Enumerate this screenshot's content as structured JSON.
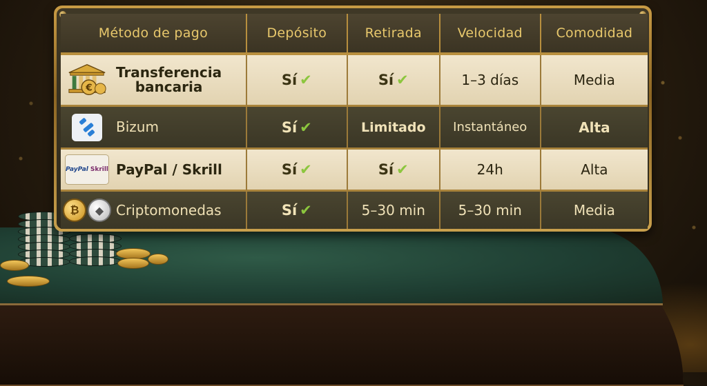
{
  "headers": {
    "method": "Método de pago",
    "deposit": "Depósito",
    "withdrawal": "Retirada",
    "speed": "Velocidad",
    "convenience": "Comodidad"
  },
  "rows": [
    {
      "method_line1": "Transferencia",
      "method_line2": "bancaria",
      "icon": "bank-euro-icon",
      "deposit": "Sí",
      "withdrawal": "Sí",
      "speed": "1–3 días",
      "convenience": "Media"
    },
    {
      "method_line1": "Bizum",
      "icon": "bizum-icon",
      "deposit": "Sí",
      "withdrawal": "Limitado",
      "speed": "Instantáneo",
      "convenience": "Alta"
    },
    {
      "method_line1": "PayPal / Skrill",
      "icon": "paypal-skrill-icon",
      "icon_text_1": "PayPal",
      "icon_text_2": "Skrill",
      "deposit": "Sí",
      "withdrawal": "Sí",
      "speed": "24h",
      "convenience": "Alta"
    },
    {
      "method_line1": "Criptomonedas",
      "icon": "crypto-coins-icon",
      "deposit": "Sí",
      "withdrawal": "5–30 min",
      "speed": "5–30 min",
      "convenience": "Media"
    }
  ],
  "check_glyph": "✔",
  "colors": {
    "gold": "#c89b45",
    "header_text": "#e8c86c",
    "check_green": "#8cc63e",
    "felt_green": "#2f5a47"
  }
}
